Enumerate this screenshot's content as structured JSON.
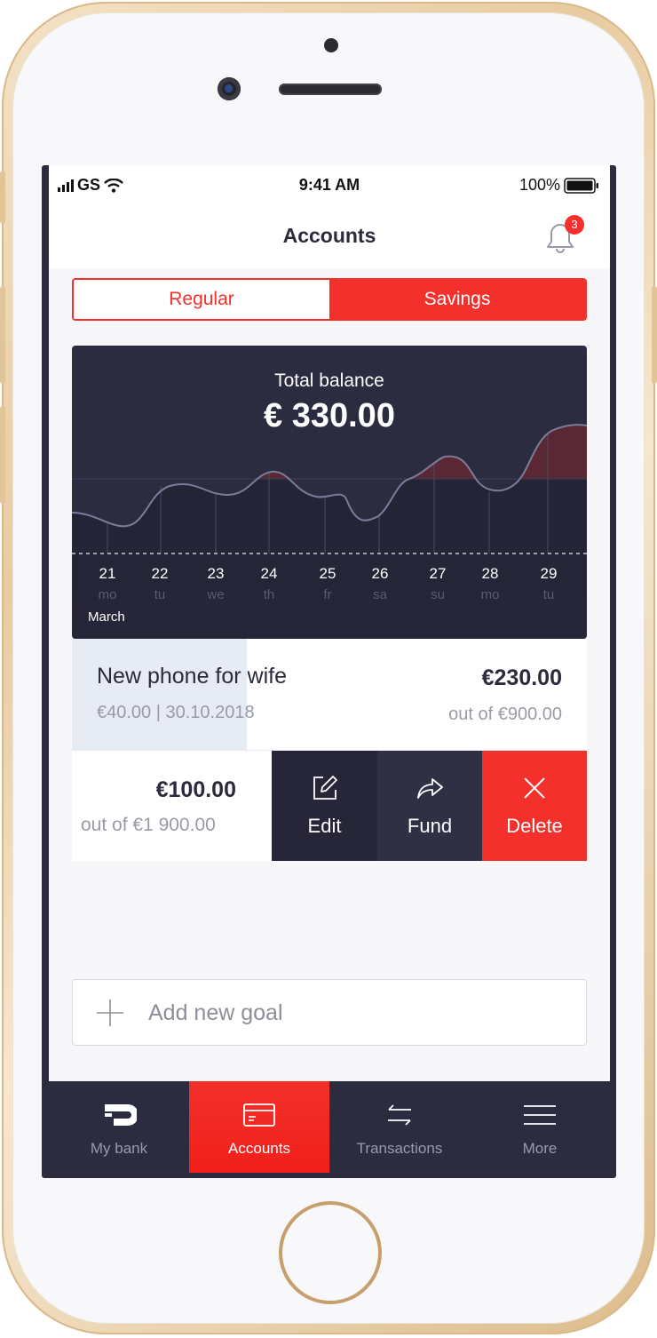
{
  "status_bar": {
    "carrier": "GS",
    "time": "9:41 AM",
    "battery": "100%"
  },
  "header": {
    "title": "Accounts",
    "notification_count": "3"
  },
  "segment": {
    "regular_label": "Regular",
    "savings_label": "Savings",
    "selected": "Savings"
  },
  "balance_card": {
    "label": "Total balance",
    "amount": "€ 330.00",
    "month": "March",
    "days": [
      {
        "num": "21",
        "wd": "mo"
      },
      {
        "num": "22",
        "wd": "tu"
      },
      {
        "num": "23",
        "wd": "we"
      },
      {
        "num": "24",
        "wd": "th"
      },
      {
        "num": "25",
        "wd": "fr"
      },
      {
        "num": "26",
        "wd": "sa"
      },
      {
        "num": "27",
        "wd": "su"
      },
      {
        "num": "28",
        "wd": "mo"
      },
      {
        "num": "29",
        "wd": "tu"
      }
    ]
  },
  "goals": [
    {
      "name": "New phone for wife",
      "sub": "€40.00 | 30.10.2018",
      "amount": "€230.00",
      "out_of": "out of €900.00",
      "progress": 0.34
    },
    {
      "amount": "€100.00",
      "out_of": "out of €1 900.00"
    }
  ],
  "actions": {
    "edit": "Edit",
    "fund": "Fund",
    "delete": "Delete"
  },
  "add_goal": {
    "label": "Add new goal"
  },
  "tabbar": {
    "items": [
      {
        "label": "My bank",
        "icon": "bank-logo-icon"
      },
      {
        "label": "Accounts",
        "icon": "card-icon"
      },
      {
        "label": "Transactions",
        "icon": "transfer-arrows-icon"
      },
      {
        "label": "More",
        "icon": "hamburger-menu-icon"
      }
    ],
    "active": "Accounts"
  },
  "colors": {
    "accent": "#f3302b",
    "dark": "#2c2c41",
    "background": "#f7f7f9"
  }
}
